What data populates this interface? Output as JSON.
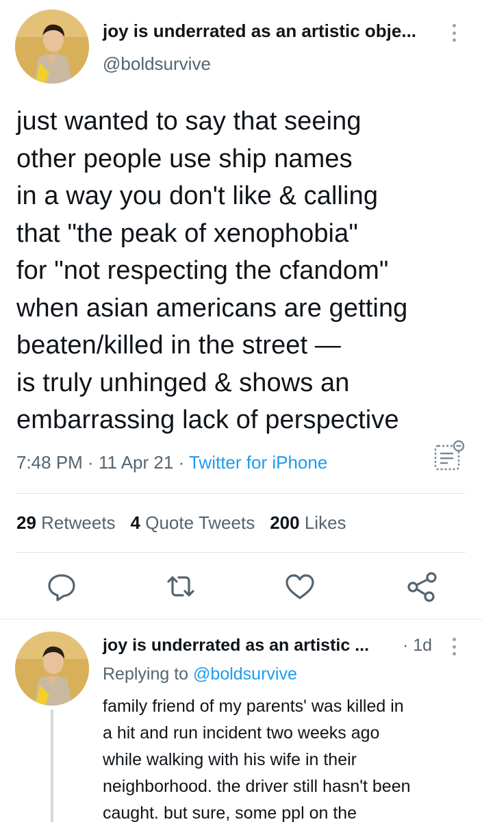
{
  "tweet": {
    "author_name": "joy is underrated as an artistic obje...",
    "handle": "@boldsurvive",
    "text_lines": [
      "just wanted to say that seeing",
      "other people use ship names",
      "in a way you don't like & calling",
      "that \"the peak of xenophobia\"",
      "for \"not respecting the cfandom\"",
      "when asian americans are getting",
      "beaten/killed in the street —",
      "is truly unhinged & shows an",
      "embarrassing lack of perspective"
    ],
    "time": "7:48 PM",
    "date": "11 Apr 21",
    "source": "Twitter for iPhone",
    "separator": " · ",
    "stats": {
      "retweets_count": "29",
      "retweets_label": "Retweets",
      "quotes_count": "4",
      "quotes_label": "Quote Tweets",
      "likes_count": "200",
      "likes_label": "Likes"
    },
    "icons": {
      "more": "more-vertical-icon",
      "analytics": "analytics-icon",
      "reply": "reply-icon",
      "retweet": "retweet-icon",
      "like": "heart-icon",
      "share": "share-icon"
    }
  },
  "reply": {
    "author_name": "joy is underrated as an artistic ...",
    "time": "· 1d",
    "replying_prefix": "Replying to",
    "replying_to": "@boldsurvive",
    "text_lines": [
      "family friend of my parents' was killed in",
      "a hit and run incident two weeks ago",
      "while walking with his wife in their",
      "neighborhood. the driver still hasn't been",
      "caught. but sure, some ppl on the"
    ]
  },
  "colors": {
    "text_primary": "#0f1419",
    "text_secondary": "#536471",
    "accent": "#1d9bf0",
    "divider": "#e1e6ea"
  }
}
